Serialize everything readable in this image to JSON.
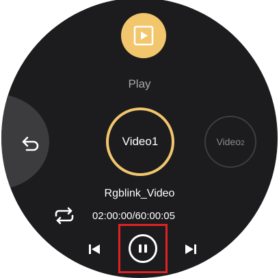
{
  "mode": {
    "label": "Play",
    "icon": "play-square-icon"
  },
  "videos": [
    {
      "label": "Video1",
      "selected": true
    },
    {
      "label_main": "Video",
      "label_sub": "2",
      "selected": false
    }
  ],
  "now_playing": {
    "title": "Rgblink_Video",
    "time": "02:00:00/60:00:05"
  },
  "controls": {
    "back": "back-arrow-icon",
    "loop": "loop-icon",
    "previous": "skip-previous-icon",
    "pause": "pause-icon",
    "next": "skip-next-icon"
  },
  "colors": {
    "accent": "#f1c66d",
    "background": "#1c1c1e",
    "highlight": "#e02222"
  }
}
